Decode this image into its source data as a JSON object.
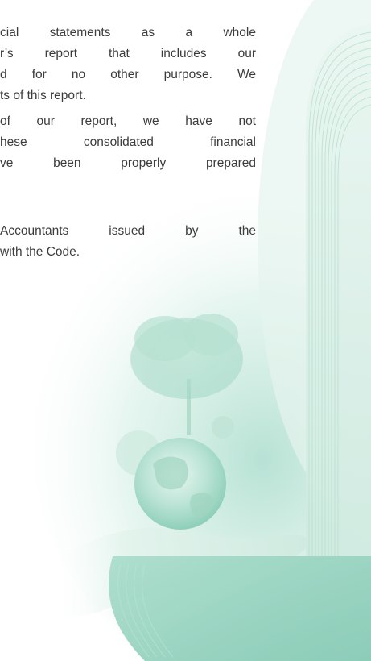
{
  "paragraphs": [
    {
      "lines": [
        "cial statements as a whole",
        "r’s report that includes our",
        "d for no other purpose. We",
        "ts of this report."
      ]
    },
    {
      "lines": [
        "of our report, we have not",
        "hese consolidated financial",
        "ve been properly prepared"
      ]
    },
    {
      "lines": [
        "Accountants issued by the",
        "with the Code."
      ]
    }
  ],
  "colors": {
    "text": "#3c3c3c",
    "accent_green": "#7cc6ae",
    "light_green": "#d8efe6",
    "background": "#ffffff"
  }
}
